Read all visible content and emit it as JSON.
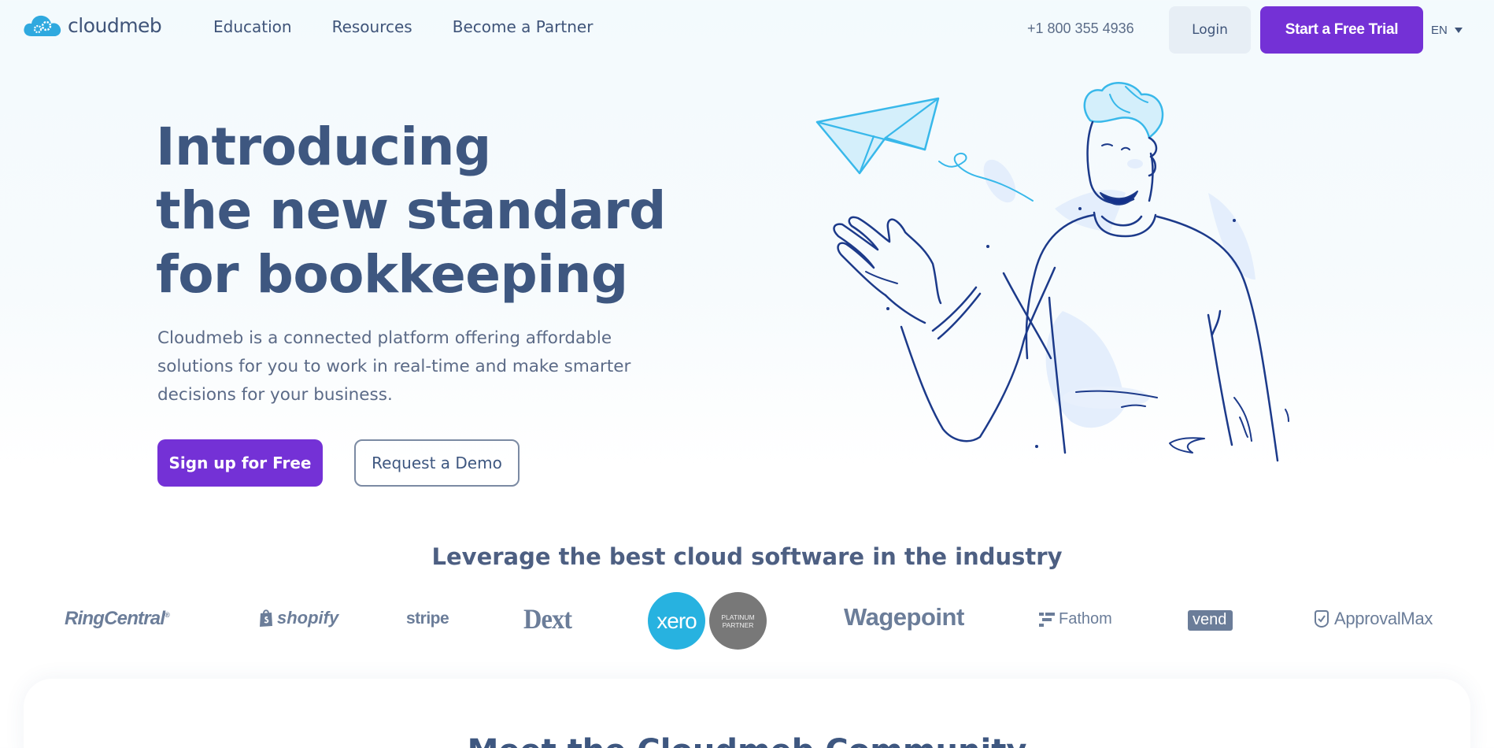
{
  "brand": {
    "name": "cloudmeb"
  },
  "nav": {
    "items": [
      {
        "label": "Education"
      },
      {
        "label": "Resources"
      },
      {
        "label": "Become a Partner"
      }
    ]
  },
  "header": {
    "phone": "+1 800 355 4936",
    "login_label": "Login",
    "trial_label": "Start a Free Trial",
    "language": "EN"
  },
  "hero": {
    "title_lines": [
      "Introducing",
      "the new standard",
      "for bookkeeping"
    ],
    "description": "Cloudmeb is a connected platform offering affordable solutions for you to work in real-time and make smarter decisions for your business.",
    "primary_cta": "Sign up for Free",
    "secondary_cta": "Request a Demo"
  },
  "partners": {
    "heading": "Leverage the best cloud software in the industry",
    "logos": [
      {
        "name": "RingCentral",
        "mark": "®"
      },
      {
        "name": "shopify"
      },
      {
        "name": "stripe"
      },
      {
        "name": "Dext"
      },
      {
        "name": "xero"
      },
      {
        "name": "PLATINUM PARTNER",
        "lines": [
          "PLATINUM",
          "PARTNER"
        ]
      },
      {
        "name": "Wagepoint"
      },
      {
        "name": "Fathom"
      },
      {
        "name": "vend"
      },
      {
        "name": "ApprovalMax"
      }
    ]
  },
  "community": {
    "title": "Meet the Cloudmeb Community"
  },
  "colors": {
    "accent": "#7431d6",
    "text": "#3e5780",
    "illustration_line": "#1c3a8a",
    "illustration_blue": "#38b8ea",
    "xero": "#27b2e0"
  },
  "icons": [
    "cloud-gear-logo-icon",
    "chevron-down-icon",
    "shopify-bag-icon",
    "fathom-icon",
    "approvalmax-check-icon"
  ]
}
